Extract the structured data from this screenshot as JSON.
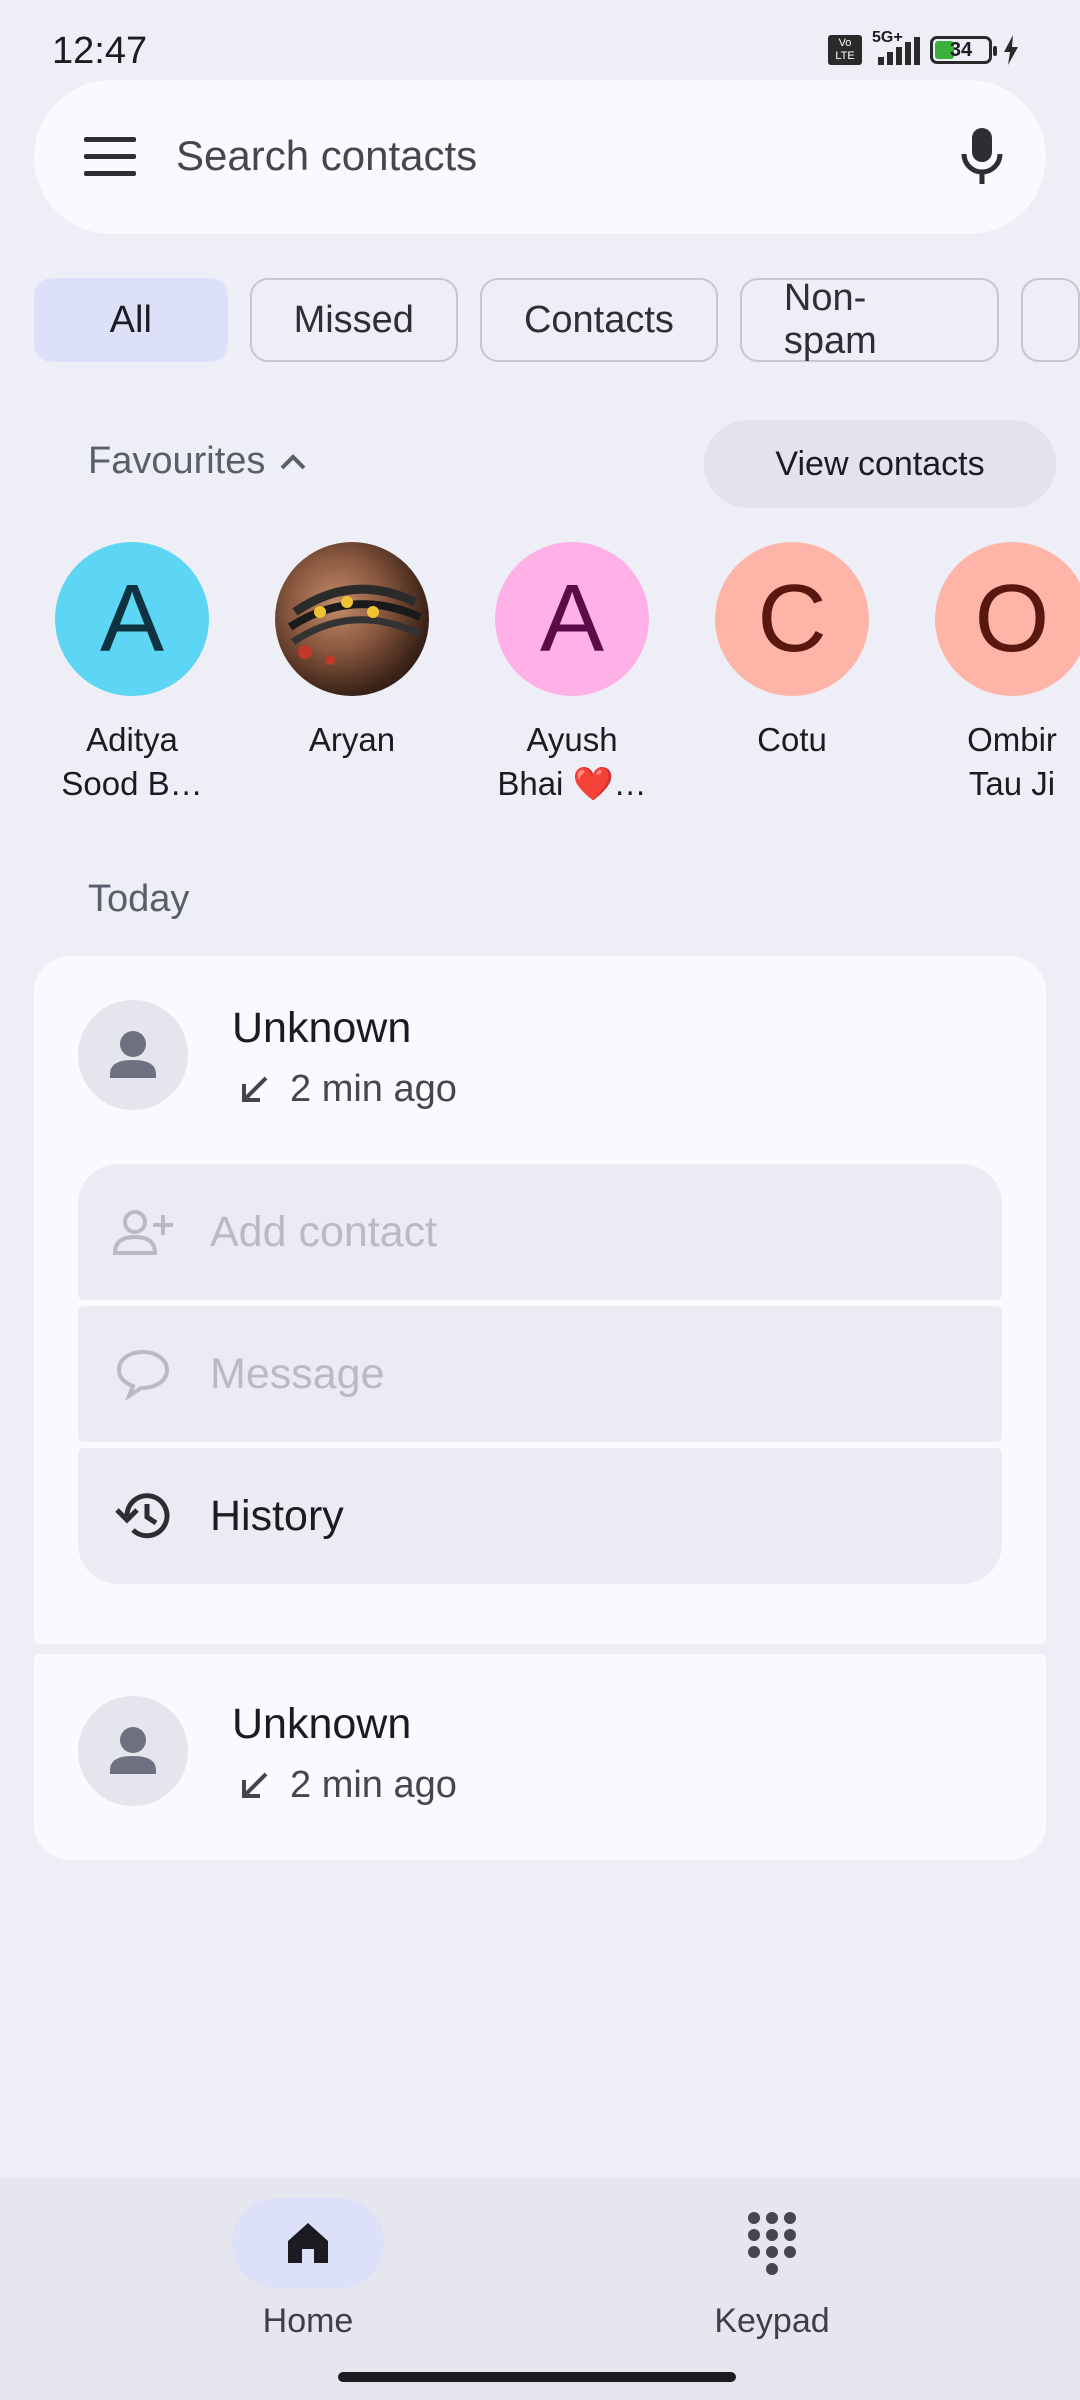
{
  "status_bar": {
    "time": "12:47",
    "volte": "Vo LTE",
    "network": "5G+",
    "battery": "34"
  },
  "search": {
    "placeholder": "Search contacts"
  },
  "filters": [
    "All",
    "Missed",
    "Contacts",
    "Non-spam"
  ],
  "favourites": {
    "title": "Favourites",
    "view_contacts": "View contacts",
    "items": [
      {
        "initial": "A",
        "name_line1": "Aditya",
        "name_line2": "Sood B…",
        "bg": "#5DD5F5",
        "fg": "#0E3240"
      },
      {
        "initial": "",
        "name_line1": "Aryan",
        "name_line2": "",
        "bg": "#7B4A37",
        "fg": "#ffffff"
      },
      {
        "initial": "A",
        "name_line1": "Ayush",
        "name_line2": "Bhai ❤️…",
        "bg": "#FFB0E6",
        "fg": "#5B0B48"
      },
      {
        "initial": "C",
        "name_line1": "Cotu",
        "name_line2": "",
        "bg": "#FFB4A8",
        "fg": "#5A1710"
      },
      {
        "initial": "O",
        "name_line1": "Ombir",
        "name_line2": "Tau Ji",
        "bg": "#FFB4A8",
        "fg": "#5A1710"
      }
    ]
  },
  "section_today": "Today",
  "calls": [
    {
      "name": "Unknown",
      "time": "2 min ago"
    },
    {
      "name": "Unknown",
      "time": "2 min ago"
    }
  ],
  "actions": {
    "add_contact": "Add contact",
    "message": "Message",
    "history": "History"
  },
  "nav": {
    "home": "Home",
    "keypad": "Keypad"
  },
  "colors": {
    "background": "#EEEEF7",
    "card": "#FAF9FE",
    "active_chip": "#DCE1F9"
  }
}
